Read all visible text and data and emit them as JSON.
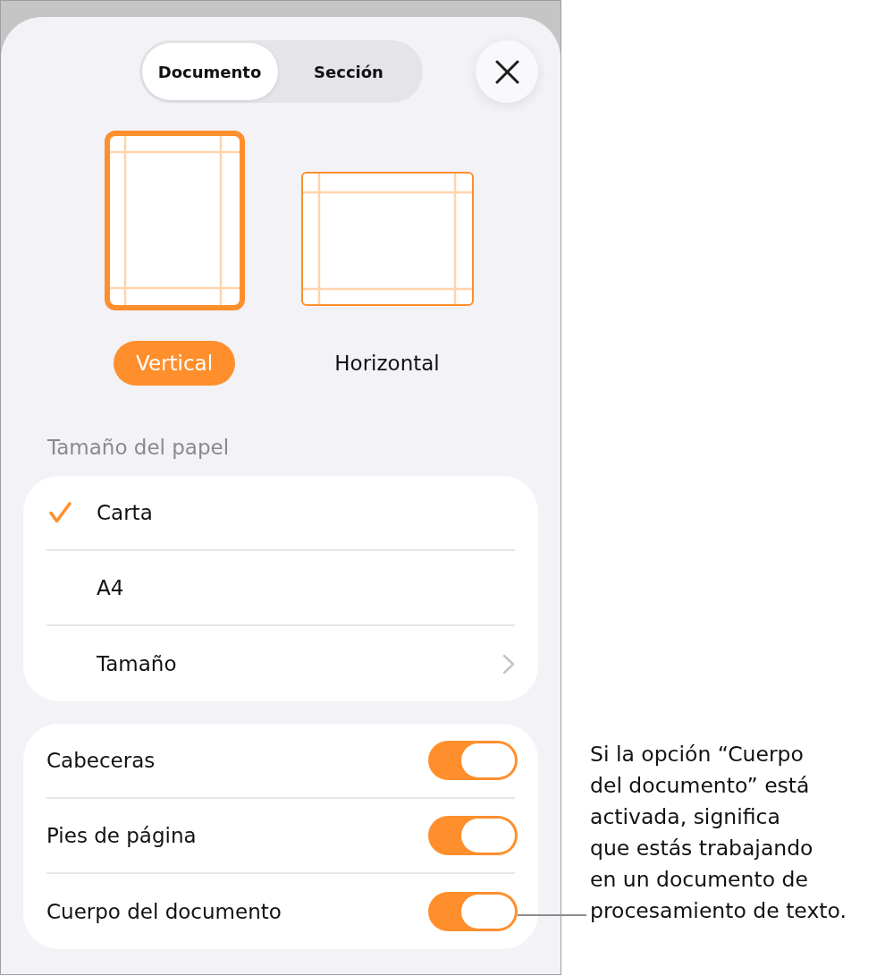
{
  "segments": [
    {
      "label": "Documento",
      "selected": true
    },
    {
      "label": "Sección",
      "selected": false
    }
  ],
  "orientations": [
    {
      "kind": "portrait",
      "label": "Vertical",
      "selected": true
    },
    {
      "kind": "landscape",
      "label": "Horizontal",
      "selected": false
    }
  ],
  "paper_size": {
    "heading": "Tamaño del papel",
    "options": [
      {
        "kind": "choice",
        "label": "Carta",
        "selected": true
      },
      {
        "kind": "choice",
        "label": "A4",
        "selected": false
      },
      {
        "kind": "submenu",
        "label": "Tamaño",
        "selected": false
      }
    ]
  },
  "toggles": [
    {
      "label": "Cabeceras",
      "on": true
    },
    {
      "label": "Pies de página",
      "on": true
    },
    {
      "label": "Cuerpo del documento",
      "on": true
    }
  ],
  "callout": {
    "text": "Si la opción “Cuerpo\ndel documento” está\nactivada, significa\nque estás trabajando\nen un documento de\nprocesamiento de texto."
  }
}
